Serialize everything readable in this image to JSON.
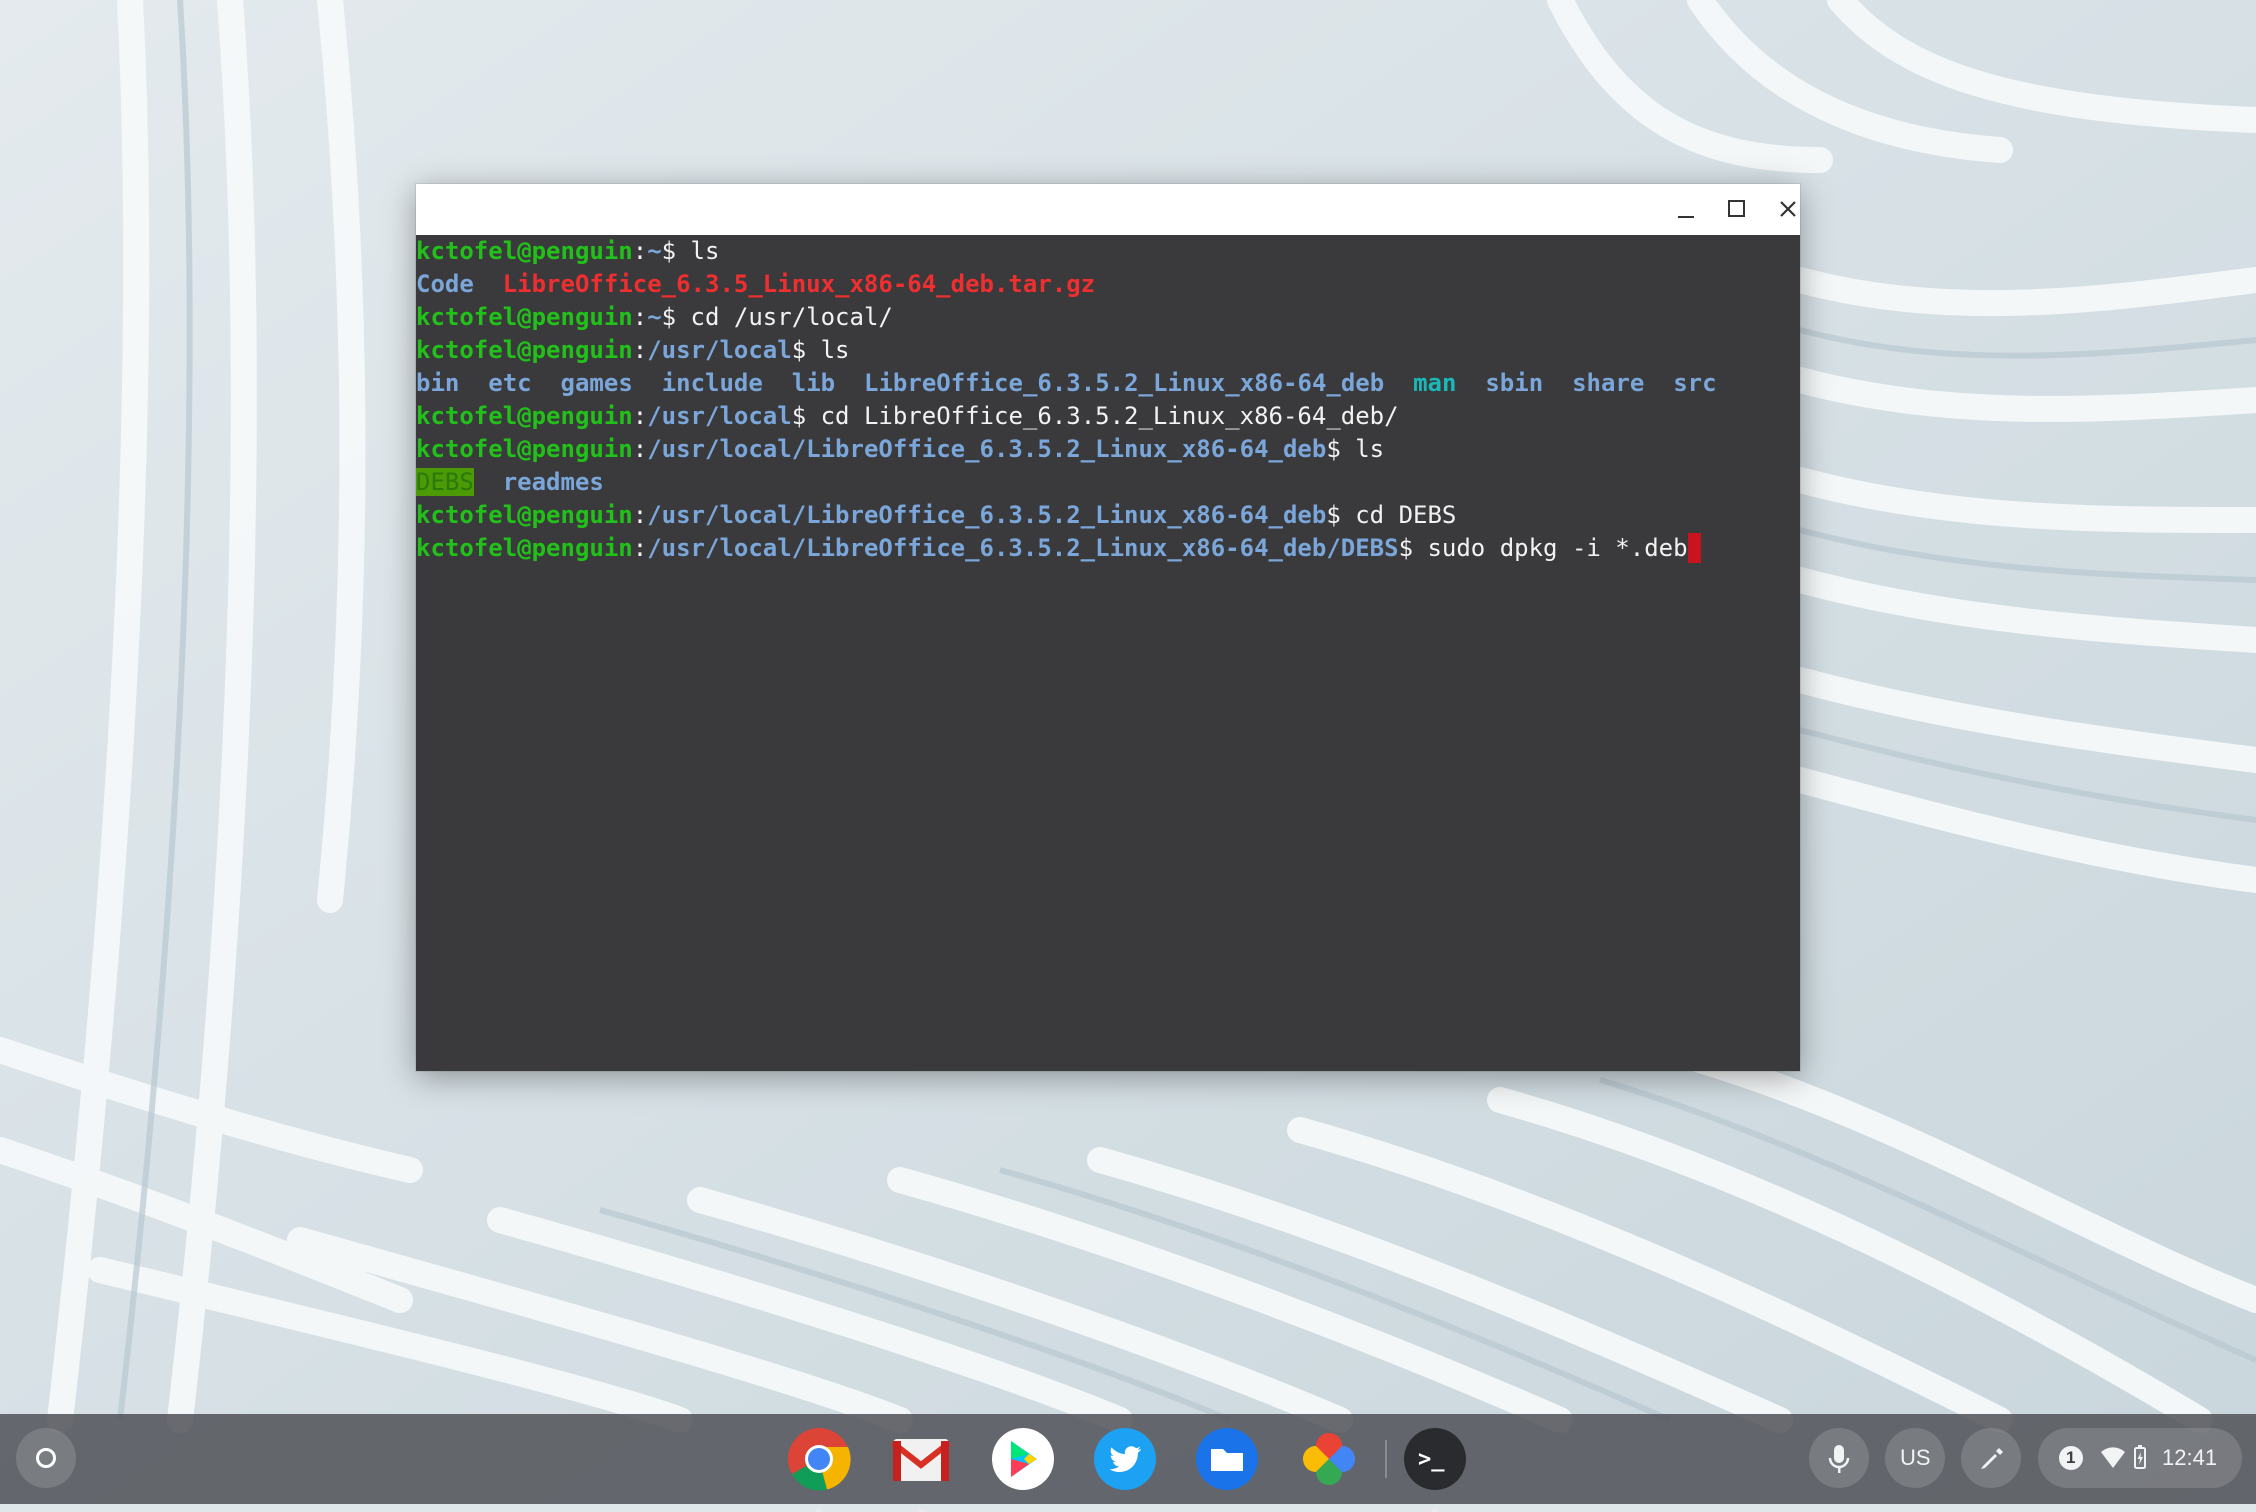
{
  "terminal": {
    "lines": [
      [
        {
          "t": "kctofel@penguin",
          "c": "g"
        },
        {
          "t": ":",
          "c": "w"
        },
        {
          "t": "~",
          "c": "b"
        },
        {
          "t": "$ ls",
          "c": "w"
        }
      ],
      [
        {
          "t": "Code",
          "c": "b"
        },
        {
          "t": "  ",
          "c": "w"
        },
        {
          "t": "LibreOffice_6.3.5_Linux_x86-64_deb.tar.gz",
          "c": "r"
        }
      ],
      [
        {
          "t": "kctofel@penguin",
          "c": "g"
        },
        {
          "t": ":",
          "c": "w"
        },
        {
          "t": "~",
          "c": "b"
        },
        {
          "t": "$ cd /usr/local/",
          "c": "w"
        }
      ],
      [
        {
          "t": "kctofel@penguin",
          "c": "g"
        },
        {
          "t": ":",
          "c": "w"
        },
        {
          "t": "/usr/local",
          "c": "b"
        },
        {
          "t": "$ ls",
          "c": "w"
        }
      ],
      [
        {
          "t": "bin",
          "c": "b"
        },
        {
          "t": "  ",
          "c": "w"
        },
        {
          "t": "etc",
          "c": "b"
        },
        {
          "t": "  ",
          "c": "w"
        },
        {
          "t": "games",
          "c": "b"
        },
        {
          "t": "  ",
          "c": "w"
        },
        {
          "t": "include",
          "c": "b"
        },
        {
          "t": "  ",
          "c": "w"
        },
        {
          "t": "lib",
          "c": "b"
        },
        {
          "t": "  ",
          "c": "w"
        },
        {
          "t": "LibreOffice_6.3.5.2_Linux_x86-64_deb",
          "c": "b"
        },
        {
          "t": "  ",
          "c": "w"
        },
        {
          "t": "man",
          "c": "c"
        },
        {
          "t": "  ",
          "c": "w"
        },
        {
          "t": "sbin",
          "c": "b"
        },
        {
          "t": "  ",
          "c": "w"
        },
        {
          "t": "share",
          "c": "b"
        },
        {
          "t": "  ",
          "c": "w"
        },
        {
          "t": "src",
          "c": "b"
        }
      ],
      [
        {
          "t": "kctofel@penguin",
          "c": "g"
        },
        {
          "t": ":",
          "c": "w"
        },
        {
          "t": "/usr/local",
          "c": "b"
        },
        {
          "t": "$ cd LibreOffice_6.3.5.2_Linux_x86-64_deb/",
          "c": "w"
        }
      ],
      [
        {
          "t": "kctofel@penguin",
          "c": "g"
        },
        {
          "t": ":",
          "c": "w"
        },
        {
          "t": "/usr/local/LibreOffice_6.3.5.2_Linux_x86-64_deb",
          "c": "b"
        },
        {
          "t": "$ ls",
          "c": "w"
        }
      ],
      [
        {
          "t": "DEBS",
          "c": "hl"
        },
        {
          "t": "  ",
          "c": "w"
        },
        {
          "t": "readmes",
          "c": "b"
        }
      ],
      [
        {
          "t": "kctofel@penguin",
          "c": "g"
        },
        {
          "t": ":",
          "c": "w"
        },
        {
          "t": "/usr/local/LibreOffice_6.3.5.2_Linux_x86-64_deb",
          "c": "b"
        },
        {
          "t": "$ cd DEBS",
          "c": "w"
        }
      ],
      [
        {
          "t": "kctofel@penguin",
          "c": "g"
        },
        {
          "t": ":",
          "c": "w"
        },
        {
          "t": "/usr/local/LibreOffice_6.3.5.2_Linux_x86-64_deb/DEBS",
          "c": "b"
        },
        {
          "t": "$ sudo dpkg -i *.deb",
          "c": "w"
        }
      ]
    ],
    "colors": {
      "prompt_user": "#22c11a",
      "path": "#7aa6da",
      "archive": "#ef2f2f",
      "symlink": "#1ab8b8",
      "background": "#3a3a3c",
      "cursor": "#c8141e"
    }
  },
  "window_controls": {
    "minimize": "minimize-icon",
    "maximize": "maximize-icon",
    "close": "close-icon"
  },
  "shelf": {
    "apps": [
      "chrome",
      "gmail",
      "play-store",
      "twitter",
      "files",
      "photos",
      "terminal"
    ],
    "terminal_glyph": ">_",
    "status": {
      "keyboard_layout": "US",
      "notification_count": "1",
      "time": "12:41"
    }
  }
}
